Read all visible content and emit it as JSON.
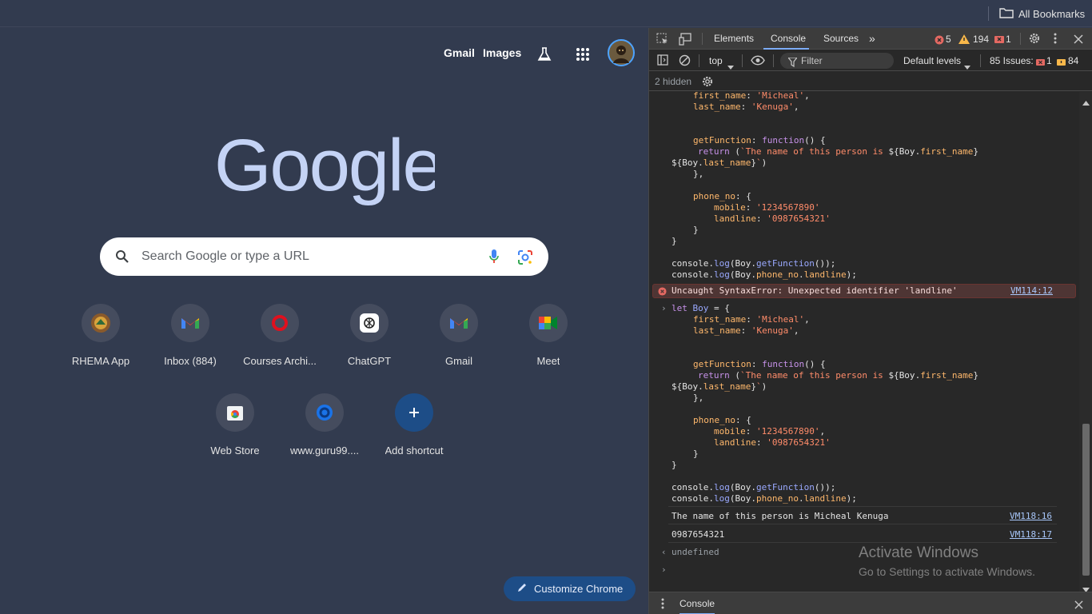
{
  "bookmarks_bar": {
    "all_bookmarks_label": "All Bookmarks"
  },
  "ntp": {
    "top_links": {
      "gmail": "Gmail",
      "images": "Images"
    },
    "search_placeholder": "Search Google or type a URL",
    "shortcuts": [
      {
        "label": "RHEMA App",
        "icon": "rhema-logo-icon"
      },
      {
        "label": "Inbox (884)",
        "icon": "gmail-icon"
      },
      {
        "label": "Courses Archi...",
        "icon": "red-ring-icon"
      },
      {
        "label": "ChatGPT",
        "icon": "chatgpt-icon"
      },
      {
        "label": "Gmail",
        "icon": "gmail-icon"
      },
      {
        "label": "Meet",
        "icon": "meet-icon"
      },
      {
        "label": "Web Store",
        "icon": "web-store-icon"
      },
      {
        "label": "www.guru99....",
        "icon": "guru99-icon"
      },
      {
        "label": "Add shortcut",
        "icon": "plus-icon"
      }
    ],
    "customize_label": "Customize Chrome"
  },
  "devtools": {
    "tabs": {
      "elements": "Elements",
      "console": "Console",
      "sources": "Sources"
    },
    "counts": {
      "errors": "5",
      "warnings": "194",
      "issues_badge": "1"
    },
    "toolbar": {
      "context": "top",
      "filter_placeholder": "Filter",
      "levels": "Default levels",
      "issues_label": "85 Issues:",
      "issues_errors": "1",
      "issues_warnings": "84"
    },
    "hidden_label": "2 hidden",
    "error_message": "Uncaught SyntaxError: Unexpected identifier 'landline'",
    "error_link": "VM114:12",
    "output1": "The name of this person is Micheal Kenuga",
    "output1_link": "VM118:16",
    "output2": "0987654321",
    "output2_link": "VM118:17",
    "return_value": "undefined",
    "drawer_tab": "Console"
  },
  "watermark": {
    "line1": "Activate Windows",
    "line2": "Go to Settings to activate Windows."
  },
  "colors": {
    "ntp_bg": "#323b4f",
    "devtools_bg": "#282828",
    "accent": "#7cacf8",
    "customize_bg": "#1d4d87"
  }
}
